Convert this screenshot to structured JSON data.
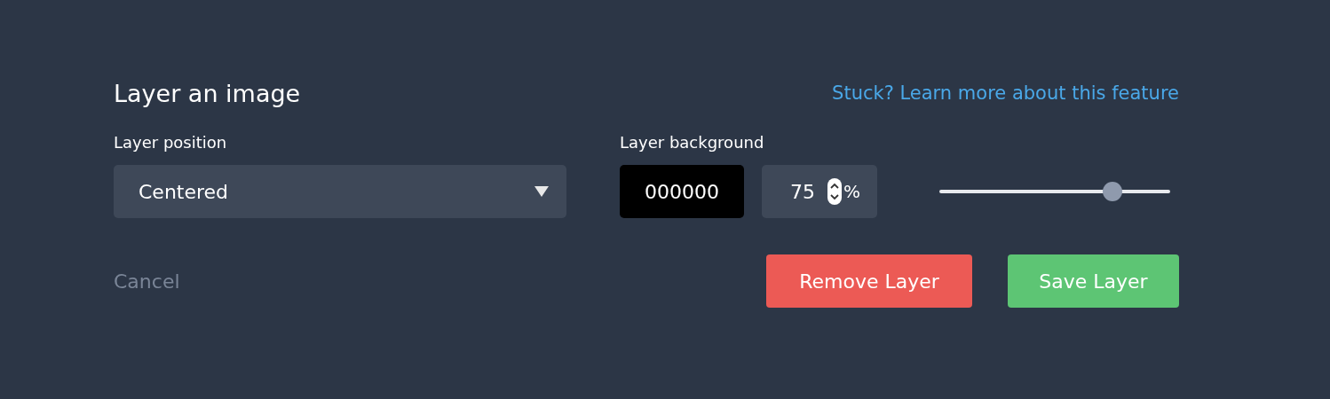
{
  "dialog": {
    "title": "Layer an image",
    "help_link": "Stuck? Learn more about this feature"
  },
  "layer_position": {
    "label": "Layer position",
    "value": "Centered"
  },
  "layer_background": {
    "label": "Layer background",
    "color_value": "000000",
    "opacity_value": "75",
    "opacity_unit": "%",
    "opacity_slider": {
      "level": 0.75
    }
  },
  "buttons": [
    {
      "label": "Cancel",
      "kind": "link"
    },
    {
      "label": "Remove Layer",
      "kind": "danger"
    },
    {
      "label": "Save Layer",
      "kind": "primary"
    }
  ]
}
